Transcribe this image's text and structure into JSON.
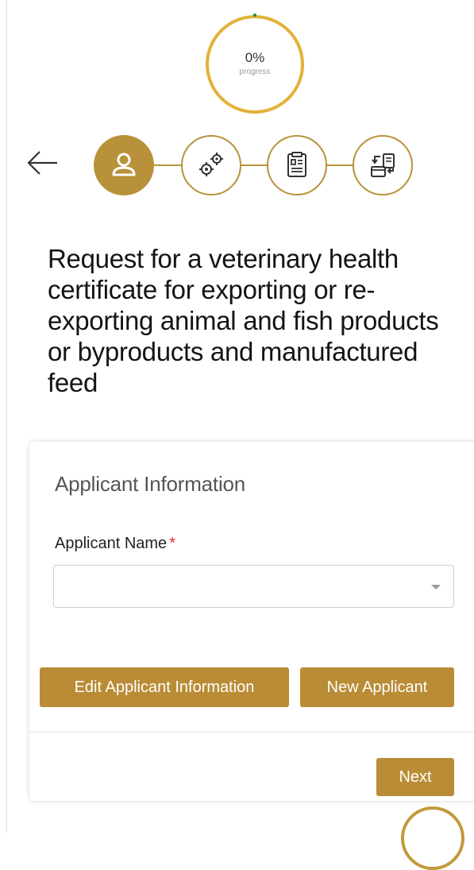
{
  "progress": {
    "percent": "0%",
    "label": "progress",
    "value": 0
  },
  "stepper": {
    "steps": [
      {
        "icon": "user-icon",
        "state": "active"
      },
      {
        "icon": "gears-icon",
        "state": "pending"
      },
      {
        "icon": "document-form-icon",
        "state": "pending"
      },
      {
        "icon": "payment-exchange-icon",
        "state": "pending"
      }
    ]
  },
  "page": {
    "title": "Request for a veterinary health certificate for exporting or re-exporting animal and fish products or byproducts and manufactured feed"
  },
  "applicant_card": {
    "title": "Applicant Information",
    "applicant_name_label": "Applicant Name",
    "required_mark": "*",
    "applicant_name_value": "",
    "edit_button": "Edit Applicant Information",
    "new_button": "New Applicant",
    "next_button": "Next"
  },
  "colors": {
    "accent": "#b98c35",
    "required": "#e12c2c",
    "progress_dot": "#1f8a3a"
  }
}
